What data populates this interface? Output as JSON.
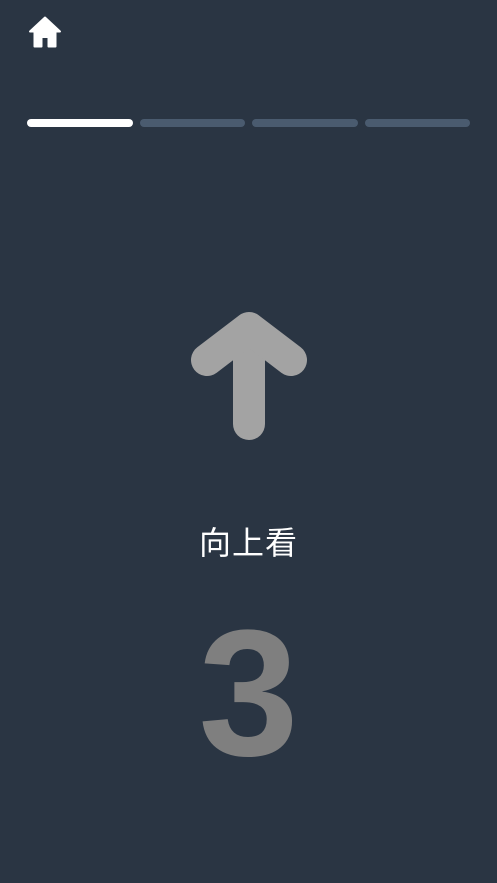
{
  "header": {
    "home_icon": "home-icon"
  },
  "progress": {
    "total_steps": 4,
    "current_step": 1
  },
  "prompt": {
    "direction_icon": "arrow-up-icon",
    "instruction": "向上看",
    "countdown": "3"
  },
  "colors": {
    "background": "#2a3543",
    "progress_active": "#ffffff",
    "progress_inactive": "#4a5b6f",
    "arrow": "#a3a3a3",
    "countdown": "#7f7f7f",
    "text": "#ffffff"
  }
}
